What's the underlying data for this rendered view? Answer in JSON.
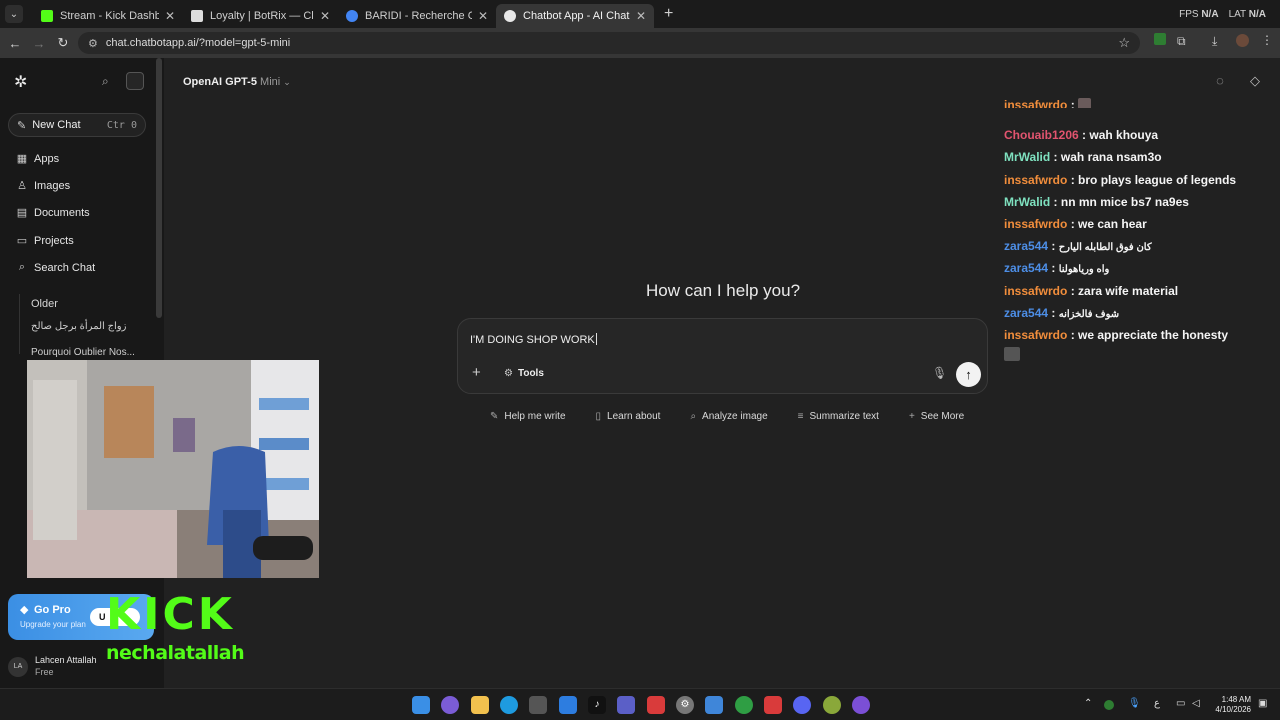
{
  "browser": {
    "tabs": [
      {
        "title": "Stream - Kick Dashboard",
        "color": "#53fc18"
      },
      {
        "title": "Loyalty | BotRix — Cloud Stream",
        "color": "#dddddd"
      },
      {
        "title": "BARIDI - Recherche Google",
        "color": "#4285f4"
      },
      {
        "title": "Chatbot App - AI Chatbot",
        "color": "#e8e8e8"
      }
    ],
    "overlay_fps": "FPS",
    "overlay_fps_val": "N/A",
    "overlay_lat": "LAT",
    "overlay_lat_val": "N/A",
    "url": "chat.chatbotapp.ai/?model=gpt-5-mini"
  },
  "sidebar": {
    "new_chat": "New Chat",
    "new_chat_kbd": "Ctr 0",
    "items": [
      "Apps",
      "Images",
      "Documents",
      "Projects",
      "Search Chat"
    ],
    "older_label": "Older",
    "history": [
      "زواج المرأة برجل صالح",
      "Pourquoi Oublier Nos..."
    ],
    "gopro_title": "Go Pro",
    "gopro_sub": "Upgrade your plan",
    "gopro_btn": "U",
    "user_initials": "LA",
    "user_name": "Lahcen Attallah",
    "user_plan": "Free"
  },
  "main": {
    "model": "OpenAI GPT-5",
    "model_variant": "Mini",
    "greeting": "How can I help you?",
    "composer_text": "I'M DOING SHOP WORK",
    "tools_label": "Tools",
    "chips": [
      "Help me write",
      "Learn about",
      "Analyze image",
      "Summarize text",
      "See More"
    ]
  },
  "stream_chat": [
    {
      "user": "inssafwrdo",
      "text": "",
      "cls": "u-orange",
      "partial": true
    },
    {
      "user": "Chouaib1206",
      "text": "wah khouya",
      "cls": "u-pink"
    },
    {
      "user": "MrWalid",
      "text": "wah rana nsam3o",
      "cls": "u-teal"
    },
    {
      "user": "inssafwrdo",
      "text": "bro plays league of legends",
      "cls": "u-orange"
    },
    {
      "user": "MrWalid",
      "text": "nn mn mice bs7 na9es",
      "cls": "u-teal"
    },
    {
      "user": "inssafwrdo",
      "text": "we can hear",
      "cls": "u-orange"
    },
    {
      "user": "zara544",
      "text": "كان فوق الطابله اليارح",
      "cls": "u-blue"
    },
    {
      "user": "zara544",
      "text": "واه ورياهولنا",
      "cls": "u-blue"
    },
    {
      "user": "inssafwrdo",
      "text": "zara wife material",
      "cls": "u-orange"
    },
    {
      "user": "zara544",
      "text": "شوف فالخزانه",
      "cls": "u-blue"
    },
    {
      "user": "inssafwrdo",
      "text": "we appreciate the honesty",
      "cls": "u-orange"
    }
  ],
  "overlay": {
    "kick_logo": "KICK",
    "channel": "nechalatallah"
  },
  "taskbar": {
    "time": "1:48 AM",
    "date": "4/10/2026",
    "lang": "ع"
  }
}
